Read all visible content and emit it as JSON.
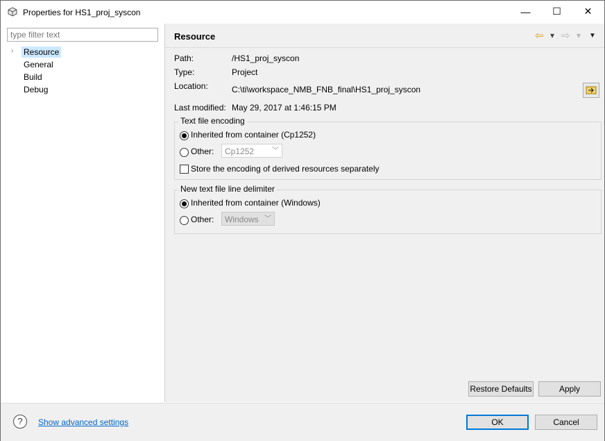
{
  "window": {
    "title": "Properties for HS1_proj_syscon",
    "minimize": "—",
    "maximize": "☐",
    "close": "✕"
  },
  "sidebar": {
    "filter_placeholder": "type filter text",
    "items": [
      {
        "label": "Resource",
        "selected": true,
        "expandable": true
      },
      {
        "label": "General"
      },
      {
        "label": "Build"
      },
      {
        "label": "Debug"
      }
    ]
  },
  "page": {
    "title": "Resource",
    "nav": {
      "back": "⇦",
      "back_menu": "▾",
      "forward": "⇨",
      "forward_menu": "▾",
      "view_menu": "▼"
    },
    "path_label": "Path:",
    "path_value": "/HS1_proj_syscon",
    "type_label": "Type:",
    "type_value": "Project",
    "location_label": "Location:",
    "location_value": "C:\\ti\\workspace_NMB_FNB_final\\HS1_proj_syscon",
    "modified_label": "Last modified:",
    "modified_value": "May 29, 2017 at 1:46:15 PM",
    "encoding": {
      "legend": "Text file encoding",
      "inherited_label": "Inherited from container (Cp1252)",
      "inherited_selected": true,
      "other_label": "Other:",
      "other_value": "Cp1252",
      "store_label": "Store the encoding of derived resources separately",
      "store_checked": false
    },
    "delimiter": {
      "legend": "New text file line delimiter",
      "inherited_label": "Inherited from container (Windows)",
      "inherited_selected": true,
      "other_label": "Other:",
      "other_value": "Windows"
    },
    "restore_defaults": "Restore Defaults",
    "apply": "Apply"
  },
  "footer": {
    "help": "?",
    "advanced_link": "Show advanced settings",
    "ok": "OK",
    "cancel": "Cancel"
  },
  "colors": {
    "selection": "#cce8ff",
    "link": "#0066cc",
    "default_button_border": "#0078d7",
    "panel_bg": "#f0f0f0"
  }
}
